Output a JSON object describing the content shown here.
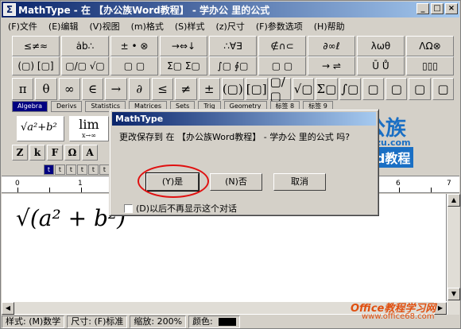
{
  "window": {
    "title": "MathType - 在 【办公族Word教程】 - 学办公 里的公式",
    "min": "_",
    "max": "□",
    "close": "×"
  },
  "menu": [
    "(F)文件",
    "(E)编辑",
    "(V)视图",
    "(m)格式",
    "(S)样式",
    "(z)尺寸",
    "(F)参数选项",
    "(H)帮助"
  ],
  "palette_row1": [
    "≤≠≈",
    "ȧb∴",
    "± • ⊗",
    "→⇔↓",
    "∴∀∃",
    "∉∩⊂",
    "∂∞ℓ",
    "λωθ",
    "ΛΩ⊗"
  ],
  "palette_row2": [
    "(▢) [▢]",
    "▢/▢ √▢",
    "▢ ▢",
    "Σ▢ Σ▢",
    "∫▢ ∮▢",
    "▢ ▢",
    "→ ⇌",
    "Ū Ů",
    "▯▯▯"
  ],
  "symbols": [
    "π",
    "θ",
    "∞",
    "∈",
    "→",
    "∂",
    "≤",
    "≠",
    "±",
    "(▢)",
    "[▢]",
    "▢/▢",
    "√▢",
    "Σ▢",
    "∫▢",
    "▢",
    "▢",
    "▢",
    "▢"
  ],
  "tabs": [
    "Algebra",
    "Derivs",
    "Statistics",
    "Matrices",
    "Sets",
    "Trig",
    "Geometry",
    "标签 8",
    "标签 9"
  ],
  "templates": {
    "sqrt": "√a²+b²",
    "lim": "lim",
    "lim_sub": "x→∞"
  },
  "letters": [
    "Z",
    "k",
    "F",
    "Ω",
    "A"
  ],
  "style_buttons": [
    "t",
    "t",
    "t",
    "t",
    "t",
    "t",
    "t"
  ],
  "ruler": {
    "zero": "0",
    "marks": [
      "1",
      "2",
      "3",
      "4",
      "5",
      "6",
      "7"
    ]
  },
  "document": {
    "equation": "√(a² + b²)"
  },
  "dialog": {
    "title": "MathType",
    "message": "更改保存到 在 【办公族Word教程】 - 学办公 里的公式 吗?",
    "yes": "(Y)是",
    "no": "(N)否",
    "cancel": "取消",
    "checkbox": "(D)以后不再显示这个对话"
  },
  "status": {
    "style": "样式: (M)数学",
    "size": "尺寸: (F)标准",
    "zoom": "缩放: 200%",
    "color": "颜色:"
  },
  "watermarks": {
    "brand": "办公族",
    "url": "Officezu.com",
    "word": "Word教程",
    "site": "Office教程学习网",
    "site_url": "www.office68.com"
  }
}
